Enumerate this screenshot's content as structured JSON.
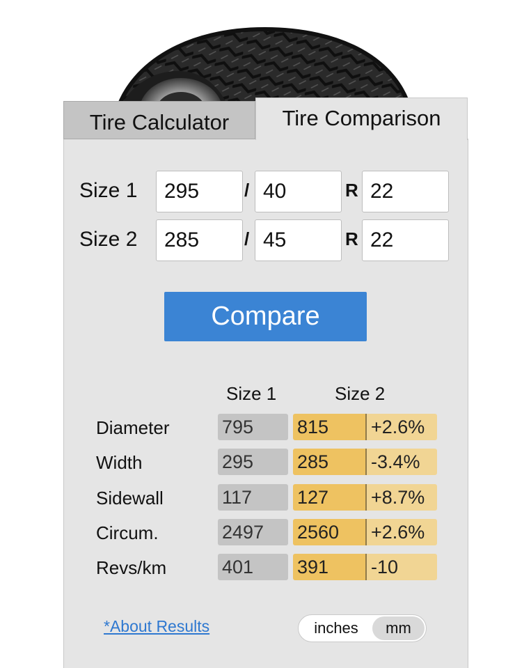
{
  "tabs": {
    "calculator": "Tire Calculator",
    "comparison": "Tire Comparison"
  },
  "inputs": {
    "size1": {
      "label": "Size 1",
      "width": "295",
      "ratio": "40",
      "rim": "22"
    },
    "size2": {
      "label": "Size 2",
      "width": "285",
      "ratio": "45",
      "rim": "22"
    },
    "slash": "/",
    "rim_marker": "R"
  },
  "compare_button": "Compare",
  "results": {
    "headers": {
      "size1": "Size 1",
      "size2": "Size 2"
    },
    "rows": [
      {
        "label": "Diameter",
        "size1": "795",
        "size2": "815",
        "diff": "+2.6%"
      },
      {
        "label": "Width",
        "size1": "295",
        "size2": "285",
        "diff": "-3.4%"
      },
      {
        "label": "Sidewall",
        "size1": "117",
        "size2": "127",
        "diff": "+8.7%"
      },
      {
        "label": "Circum.",
        "size1": "2497",
        "size2": "2560",
        "diff": "+2.6%"
      },
      {
        "label": "Revs/km",
        "size1": "401",
        "size2": "391",
        "diff": "-10"
      }
    ]
  },
  "footer": {
    "about_link": "*About Results",
    "units": {
      "inches": "inches",
      "mm": "mm",
      "selected": "mm"
    }
  },
  "colors": {
    "accent_button": "#3b84d4",
    "size1_cell": "#c4c4c4",
    "size2_cell": "#eec261",
    "diff_cell": "#f1d594",
    "link": "#2e78d0"
  },
  "icons": {
    "tire_image": "tire-image"
  }
}
